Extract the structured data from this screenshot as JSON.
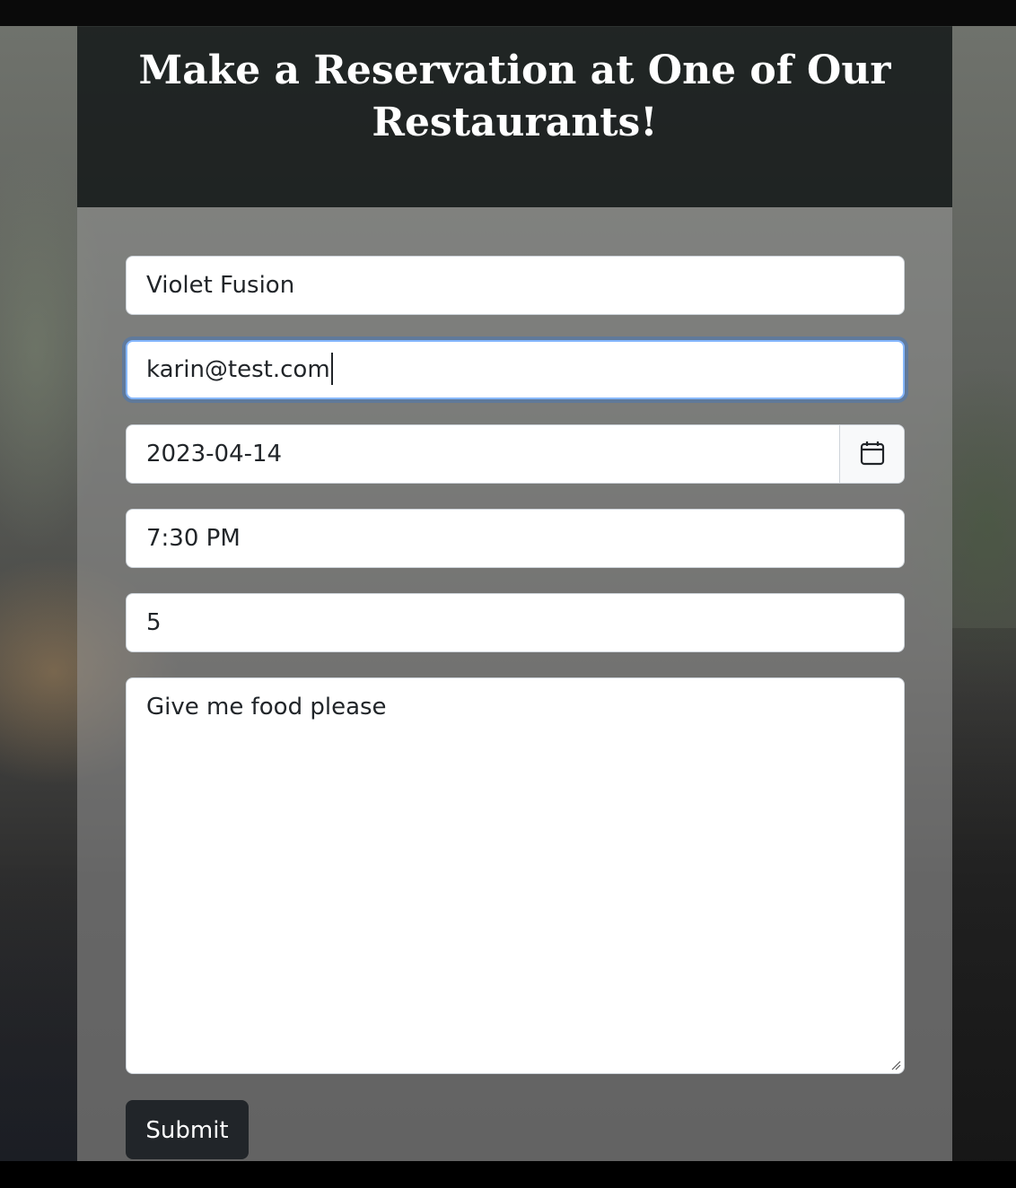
{
  "header": {
    "title": "Make a Reservation at One of Our Restaurants!"
  },
  "form": {
    "restaurant_value": "Violet Fusion",
    "email_value": "karin@test.com",
    "date_value": "2023-04-14",
    "time_value": "7:30 PM",
    "party_size_value": "5",
    "notes_value": "Give me food please",
    "submit_label": "Submit",
    "focused_field": "email"
  },
  "icons": {
    "date_picker": "calendar-icon",
    "textarea_resize": "resize-grip-icon"
  },
  "colors": {
    "header_bg": "#141818",
    "button_bg": "#212529",
    "focus_ring": "#86b7fe"
  }
}
